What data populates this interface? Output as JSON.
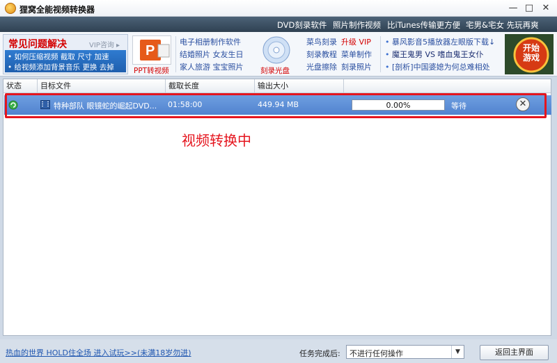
{
  "app": {
    "title": "狸窝全能视频转换器",
    "window_buttons": {
      "minimize": "—",
      "maximize": "□",
      "close": "✕"
    }
  },
  "top_links": [
    "DVD刻录软件",
    "照片制作视频",
    "比iTunes传输更方便",
    "宅男&宅女 先玩再爽"
  ],
  "banner": {
    "faq_title": "常见问题解决",
    "faq_vip": "VIP咨询 ▸",
    "faq_lines": [
      "• 如何压缩视频  截取  尺寸  加速",
      "• 给视频添加背景音乐  更换  去掉"
    ],
    "ppt_caption": "PPT转视频",
    "album_links": [
      "电子相册制作软件",
      "结婚照片  女友生日",
      "家人旅游  宝宝照片"
    ],
    "burn_caption": "刻录光盘",
    "burn_links": [
      {
        "a": "菜鸟刻录",
        "b": "升级 VIP"
      },
      {
        "a": "刻录教程",
        "b": "菜单制作"
      },
      {
        "a": "光盘擦除",
        "b": "刻录照片"
      }
    ],
    "news": [
      "暴风影音5播放器左眼版下载↓",
      "魔王鬼男  VS  嗜血鬼王女仆",
      "[剖析]中国婆媳为何总难相处"
    ],
    "game_caption": "开始游戏"
  },
  "columns": [
    "状态",
    "目标文件",
    "截取长度",
    "输出大小"
  ],
  "tasks": [
    {
      "file": "特种部队 眼镜蛇的崛起DVD...",
      "length": "01:58:00",
      "size": "449.94 MB",
      "progress": 0.0,
      "progress_text": "0.00%",
      "state": "等待"
    }
  ],
  "annotation": "视频转换中",
  "footer": {
    "link": "热血的世界 HOLD住全场 进入试玩>>(未满18岁勿进)",
    "after_label": "任务完成后:",
    "after_value": "不进行任何操作",
    "back_button": "返回主界面"
  },
  "colors": {
    "row_highlight": "#5b8ad6",
    "annotation_red": "#e5151e"
  }
}
